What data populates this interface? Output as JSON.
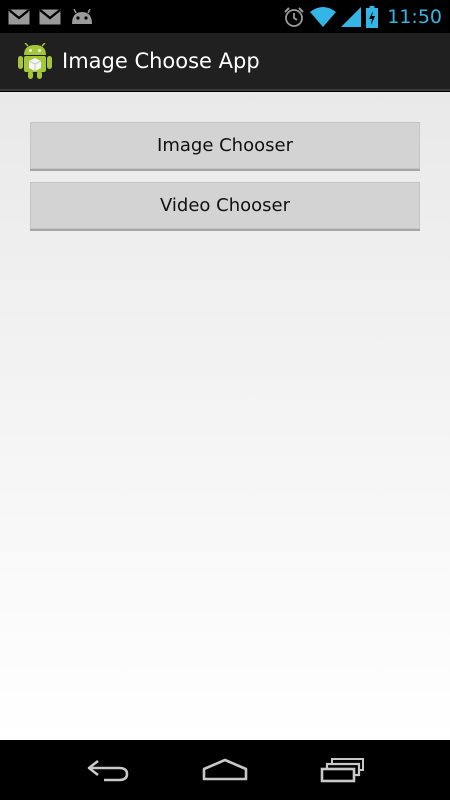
{
  "status_bar": {
    "time": "11:50",
    "notification_icons": [
      "gmail-icon",
      "gmail-icon",
      "android-debug-icon"
    ],
    "system_icons": [
      "alarm-icon",
      "wifi-icon",
      "signal-icon",
      "battery-charging-icon"
    ],
    "accent_color": "#33b5e5"
  },
  "action_bar": {
    "title": "Image Choose App",
    "app_icon": "android-robot-icon"
  },
  "main": {
    "image_chooser_label": "Image Chooser",
    "video_chooser_label": "Video Chooser"
  },
  "nav_bar": {
    "icons": [
      "back-icon",
      "home-icon",
      "recent-apps-icon"
    ]
  }
}
